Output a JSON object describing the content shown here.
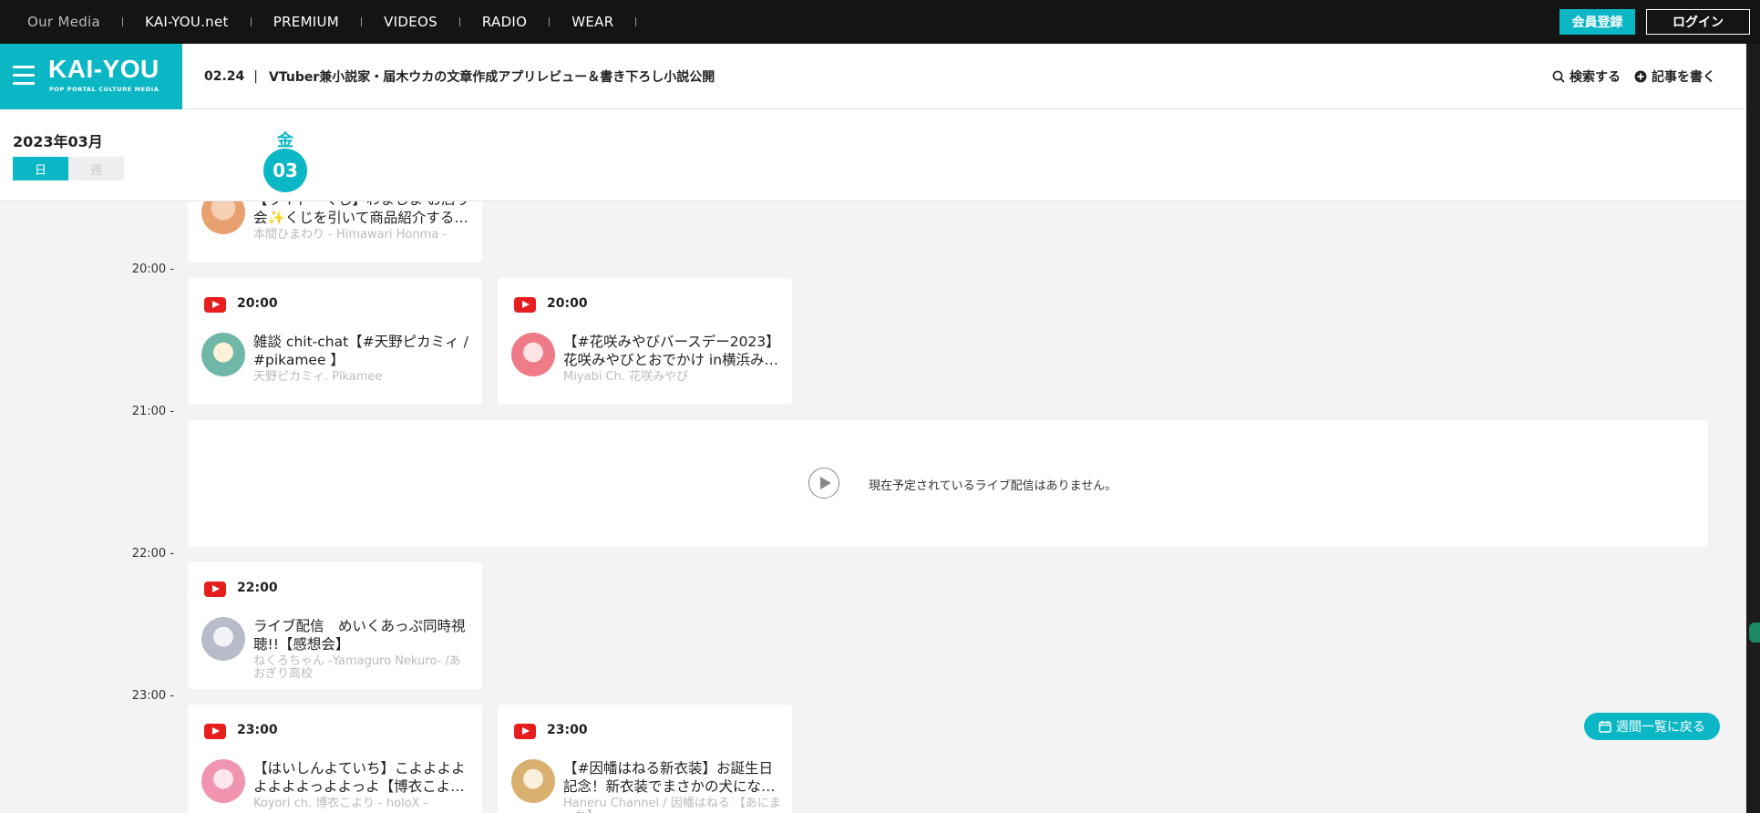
{
  "topnav": {
    "items": [
      "Our Media",
      "KAI-YOU.net",
      "PREMIUM",
      "VIDEOS",
      "RADIO",
      "WEAR"
    ],
    "register_label": "会員登録",
    "login_label": "ログイン"
  },
  "header": {
    "logo": "KAI-YOU",
    "logo_sub": "POP PORTAL CULTURE MEDIA",
    "headline_date": "02.24",
    "headline_sep": "|",
    "headline_text": "VTuber兼小説家・届木ウカの文章作成アプリレビュー＆書き下ろし小説公開",
    "search_label": "検索する",
    "write_label": "記事を書く"
  },
  "calendar": {
    "month": "2023年03月",
    "view_day": "日",
    "view_week": "週",
    "day_of_week": "金",
    "day_number": "03"
  },
  "times": [
    "20:00 -",
    "21:00 -",
    "22:00 -",
    "23:00 -"
  ],
  "cards": [
    {
      "time": "",
      "title": "【ライド・くじ】わましま お店り会✨くじを引いて商品紹介する…",
      "channel": "本間ひまわり - Himawari Honma -",
      "avatar_color": "#e8a070"
    },
    {
      "time": "20:00",
      "title": "雑談 chit-chat【#天野ピカミィ / #pikamee 】",
      "channel": "天野ピカミィ. Pikamee",
      "avatar_color": "#6fb8a8"
    },
    {
      "time": "20:00",
      "title": "【#花咲みやびバースデー2023】花咲みやびとおでかけ in横浜み…",
      "channel": "Miyabi Ch. 花咲みやび",
      "avatar_color": "#ef7a88"
    },
    {
      "time": "22:00",
      "title": "ライブ配信　めいくあっぷ同時視聴!!【感想会】",
      "channel": "ねくろちゃん -Yamaguro Nekuro- /あおぎり高校",
      "avatar_color": "#b8bcc8"
    },
    {
      "time": "23:00",
      "title": "【はいしんよていち】こよよよよよよよよっよよっよ【博衣こよ…",
      "channel": "Koyori ch. 博衣こより - holoX -",
      "avatar_color": "#f094b0"
    },
    {
      "time": "23:00",
      "title": "【#因幡はねる新衣装】お誕生日記念！新衣装でまさかの犬にな…",
      "channel": "Haneru Channel / 因幡はねる 【あにまーれ】",
      "avatar_color": "#d9b070"
    }
  ],
  "empty_message": "現在予定されているライブ配信はありません。",
  "back_to_week_label": "週間一覧に戻る",
  "colors": {
    "accent": "#0bb6c5",
    "youtube": "#e61e1e",
    "topbar": "#141414"
  }
}
